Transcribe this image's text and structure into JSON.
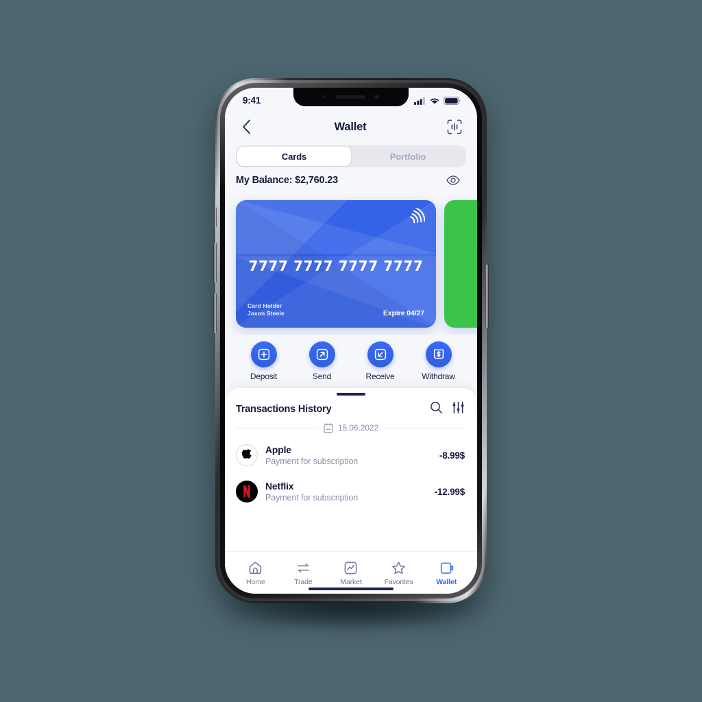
{
  "status_bar": {
    "time": "9:41",
    "icons": [
      "cellular-signal-icon",
      "wifi-icon",
      "battery-icon"
    ]
  },
  "header": {
    "back_icon": "chevron-left-icon",
    "title": "Wallet",
    "scan_icon": "scan-id-icon"
  },
  "segmented": {
    "options": [
      {
        "label": "Cards",
        "active": true
      },
      {
        "label": "Portfolio",
        "active": false
      }
    ]
  },
  "balance": {
    "label": "My Balance: $2,760.23",
    "toggle_icon": "eye-icon"
  },
  "cards": [
    {
      "color": "#3563e8",
      "number": "7777 7777 7777 7777",
      "holder_label": "Card Holder",
      "holder_name": "Jaxon Steele",
      "expire": "Expire 04/27",
      "nfc_icon": "contactless-icon"
    },
    {
      "color": "#3ac44a",
      "number": "",
      "holder_label": "",
      "holder_name": "",
      "expire": "",
      "nfc_icon": "contactless-icon"
    }
  ],
  "actions": [
    {
      "label": "Deposit",
      "icon": "plus-square-icon"
    },
    {
      "label": "Send",
      "icon": "arrow-up-right-icon"
    },
    {
      "label": "Receive",
      "icon": "arrow-down-left-icon"
    },
    {
      "label": "Withdraw",
      "icon": "dollar-bill-icon"
    }
  ],
  "transactions_panel": {
    "title": "Transactions History",
    "search_icon": "search-icon",
    "filter_icon": "filter-sliders-icon",
    "date_icon": "calendar-icon",
    "date": "15.06.2022",
    "items": [
      {
        "logo": "apple-logo-icon",
        "name": "Apple",
        "description": "Payment for subscription",
        "amount": "-8.99$"
      },
      {
        "logo": "netflix-logo-icon",
        "name": "Netflix",
        "description": "Payment for subscription",
        "amount": "-12.99$"
      }
    ]
  },
  "tabbar": {
    "items": [
      {
        "label": "Home",
        "icon": "home-icon",
        "active": false
      },
      {
        "label": "Trade",
        "icon": "exchange-icon",
        "active": false
      },
      {
        "label": "Market",
        "icon": "chart-square-icon",
        "active": false
      },
      {
        "label": "Favorites",
        "icon": "star-icon",
        "active": false
      },
      {
        "label": "Wallet",
        "icon": "wallet-icon",
        "active": true
      }
    ]
  },
  "colors": {
    "background": "#4d6670",
    "accent": "#2f6bf5",
    "card_blue": "#3563e8",
    "card_green": "#3ac44a",
    "text_dark": "#161a3d",
    "text_muted": "#8b8fa8"
  }
}
